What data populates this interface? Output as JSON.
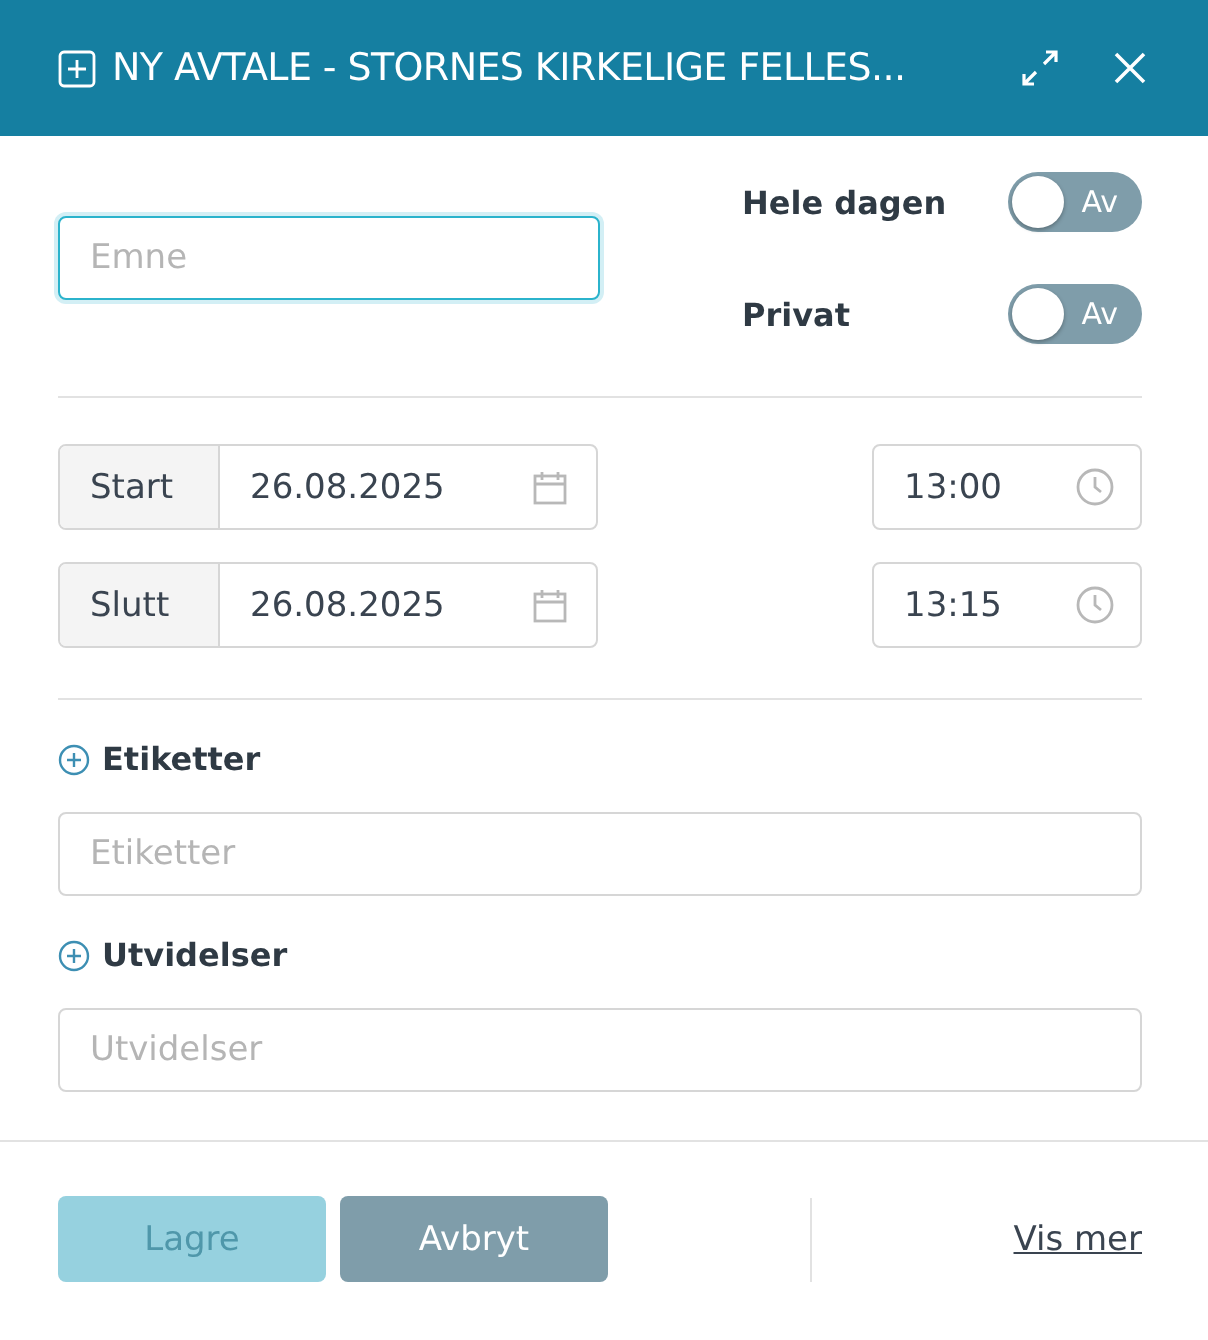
{
  "window": {
    "title": "NY AVTALE - STORNES KIRKELIGE FELLES..."
  },
  "subject": {
    "placeholder": "Emne",
    "focused": true
  },
  "toggles": [
    {
      "label": "Hele dagen",
      "on": false,
      "state_text": "Av"
    },
    {
      "label": "Privat",
      "on": false,
      "state_text": "Av"
    }
  ],
  "times": [
    {
      "label": "Start",
      "date": "26.08.2025",
      "time": "13:00"
    },
    {
      "label": "Slutt",
      "date": "26.08.2025",
      "time": "13:15"
    }
  ],
  "sections": [
    {
      "label": "Etiketter",
      "placeholder": "Etiketter"
    },
    {
      "label": "Utvidelser",
      "placeholder": "Utvidelser"
    }
  ],
  "buttons": [
    {
      "label": "Lagre",
      "kind": "primary",
      "disabled": true
    },
    {
      "label": "Avbryt",
      "kind": "secondary",
      "disabled": false
    }
  ],
  "link": "Vis mer"
}
